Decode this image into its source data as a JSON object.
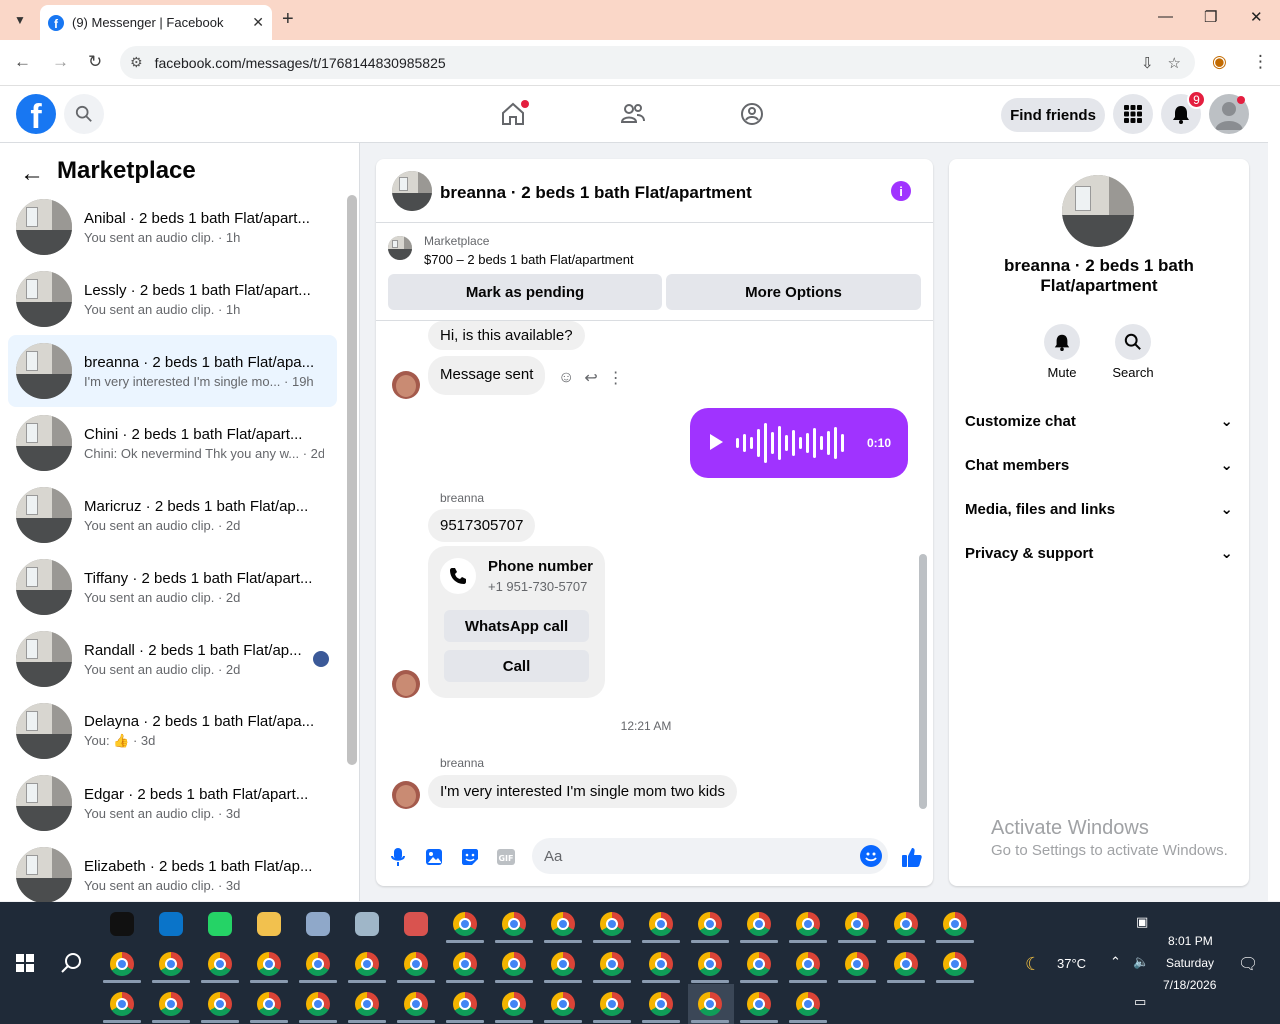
{
  "browser": {
    "tab_title": "(9) Messenger | Facebook",
    "url": "facebook.com/messages/t/1768144830985825"
  },
  "fb_header": {
    "find_friends": "Find friends",
    "notification_count": "9"
  },
  "sidebar": {
    "title": "Marketplace",
    "conversations": [
      {
        "name": "Anibal · 2 beds 1 bath Flat/apart...",
        "preview": "You sent an audio clip. · 1h"
      },
      {
        "name": "Lessly · 2 beds 1 bath Flat/apart...",
        "preview": "You sent an audio clip. · 1h"
      },
      {
        "name": "breanna · 2 beds 1 bath Flat/apa...",
        "preview": "I'm very interested I'm single mo...   · 19h"
      },
      {
        "name": "Chini · 2 beds 1 bath Flat/apart...",
        "preview": "Chini: Ok nevermind Thk you any w... · 2d"
      },
      {
        "name": "Maricruz · 2 beds 1 bath Flat/ap...",
        "preview": "You sent an audio clip. · 2d"
      },
      {
        "name": "Tiffany · 2 beds 1 bath Flat/apart...",
        "preview": "You sent an audio clip. · 2d"
      },
      {
        "name": "Randall · 2 beds 1 bath Flat/ap...",
        "preview": "You sent an audio clip. · 2d"
      },
      {
        "name": "Delayna · 2 beds 1 bath Flat/apa...",
        "preview": "You: 👍 · 3d"
      },
      {
        "name": "Edgar · 2 beds 1 bath Flat/apart...",
        "preview": "You sent an audio clip. · 3d"
      },
      {
        "name": "Elizabeth · 2 beds 1 bath Flat/ap...",
        "preview": "You sent an audio clip. · 3d"
      }
    ]
  },
  "chat": {
    "title": "breanna · 2 beds 1 bath Flat/apartment",
    "marketplace_label": "Marketplace",
    "listing": "$700 – 2 beds 1 bath Flat/apartment",
    "mark_pending": "Mark as pending",
    "more_options": "More Options",
    "messages": {
      "m1": "Hi, is this available?",
      "m2": "Message sent",
      "audio_duration": "0:10",
      "sender1": "breanna",
      "m3": "9517305707",
      "phone_title": "Phone number",
      "phone_number": "+1 951-730-5707",
      "whatsapp": "WhatsApp call",
      "call": "Call",
      "timestamp": "12:21 AM",
      "sender2": "breanna",
      "m4": "I'm very interested I'm single mom two kids"
    },
    "composer_placeholder": "Aa"
  },
  "right_panel": {
    "name": "breanna · 2 beds 1 bath Flat/apartment",
    "mute": "Mute",
    "search": "Search",
    "sections": [
      "Customize chat",
      "Chat members",
      "Media, files and links",
      "Privacy & support"
    ]
  },
  "watermark": {
    "line1": "Activate Windows",
    "line2": "Go to Settings to activate Windows."
  },
  "taskbar": {
    "weather": "37°C",
    "time": "8:01 PM",
    "day": "Saturday",
    "date": "7/18/2026"
  },
  "colors": {
    "fb_blue": "#1877f2",
    "messenger_purple": "#a033ff",
    "badge_red": "#e41e3f"
  }
}
